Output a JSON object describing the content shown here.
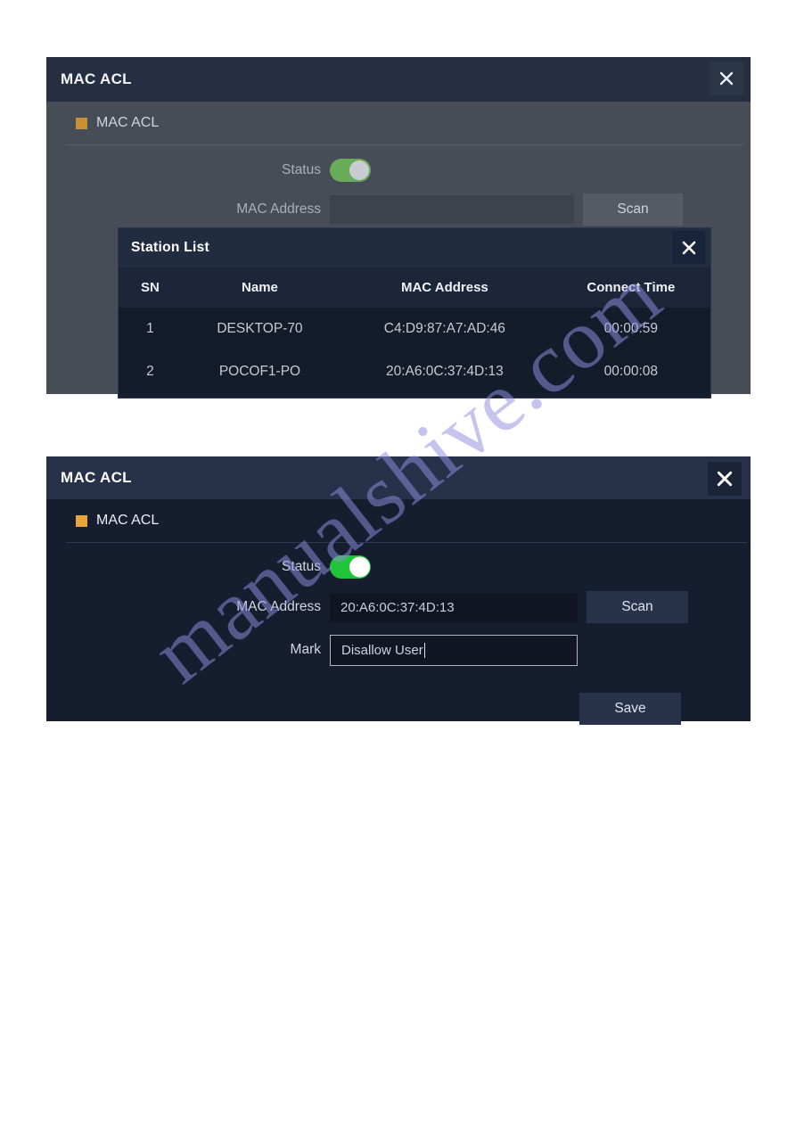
{
  "watermark": {
    "text": "manualshive.com"
  },
  "dialog_one": {
    "title": "MAC ACL",
    "close_icon": "close-icon",
    "section": {
      "label": "MAC ACL",
      "marker_color": "#c79034"
    },
    "fields": {
      "status_label": "Status",
      "status_on": true,
      "mac_label": "MAC Address",
      "mac_value": "",
      "mac_placeholder": ""
    },
    "scan_label": "Scan"
  },
  "station_list": {
    "title": "Station List",
    "close_icon": "close-icon",
    "columns": [
      "SN",
      "Name",
      "MAC Address",
      "Connect Time"
    ],
    "rows": [
      {
        "sn": "1",
        "name": "DESKTOP-70",
        "mac": "C4:D9:87:A7:AD:46",
        "time": "00:00:59"
      },
      {
        "sn": "2",
        "name": "POCOF1-PO",
        "mac": "20:A6:0C:37:4D:13",
        "time": "00:00:08"
      }
    ]
  },
  "dialog_two": {
    "title": "MAC ACL",
    "close_icon": "close-icon",
    "section": {
      "label": "MAC ACL",
      "marker_color": "#e8a33d"
    },
    "fields": {
      "status_label": "Status",
      "status_on": true,
      "mac_label": "MAC Address",
      "mac_value": "20:A6:0C:37:4D:13",
      "mark_label": "Mark",
      "mark_value": "Disallow User"
    },
    "scan_label": "Scan",
    "save_label": "Save"
  },
  "colors": {
    "toggle_on": "#1fc438",
    "toggle_on_dim": "#6aab5a",
    "accent_orange": "#e8a33d",
    "dialog_bg_dark": "#151d2e",
    "dialog_bg_dim": "#474d57"
  }
}
